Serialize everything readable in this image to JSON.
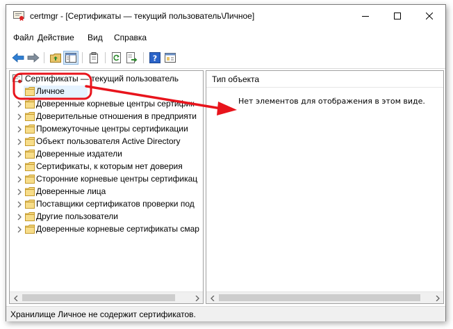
{
  "window": {
    "title": "certmgr - [Сертификаты — текущий пользователь\\Личное]"
  },
  "menu": [
    "Файл",
    "Действие",
    "Вид",
    "Справка"
  ],
  "toolbar": {
    "buttons": [
      "back-icon",
      "forward-icon",
      "up-folder-icon",
      "show-tree-icon",
      "properties-icon",
      "refresh-icon",
      "export-list-icon",
      "help-icon",
      "show-console-icon"
    ]
  },
  "tree": {
    "root": "Сертификаты — текущий пользователь",
    "items": [
      "Личное",
      "Доверенные корневые центры сертифик",
      "Доверительные отношения в предприяти",
      "Промежуточные центры сертификации",
      "Объект пользователя Active Directory",
      "Доверенные издатели",
      "Сертификаты, к которым нет доверия",
      "Сторонние корневые центры сертификац",
      "Доверенные лица",
      "Поставщики сертификатов проверки под",
      "Другие пользователи",
      "Доверенные корневые сертификаты смар"
    ],
    "selected_index": 0
  },
  "details": {
    "column_header": "Тип объекта",
    "empty_message": "Нет элементов для отображения в этом виде."
  },
  "status": "Хранилище Личное не содержит сертификатов.",
  "annotation": {
    "color": "#e8141c"
  }
}
